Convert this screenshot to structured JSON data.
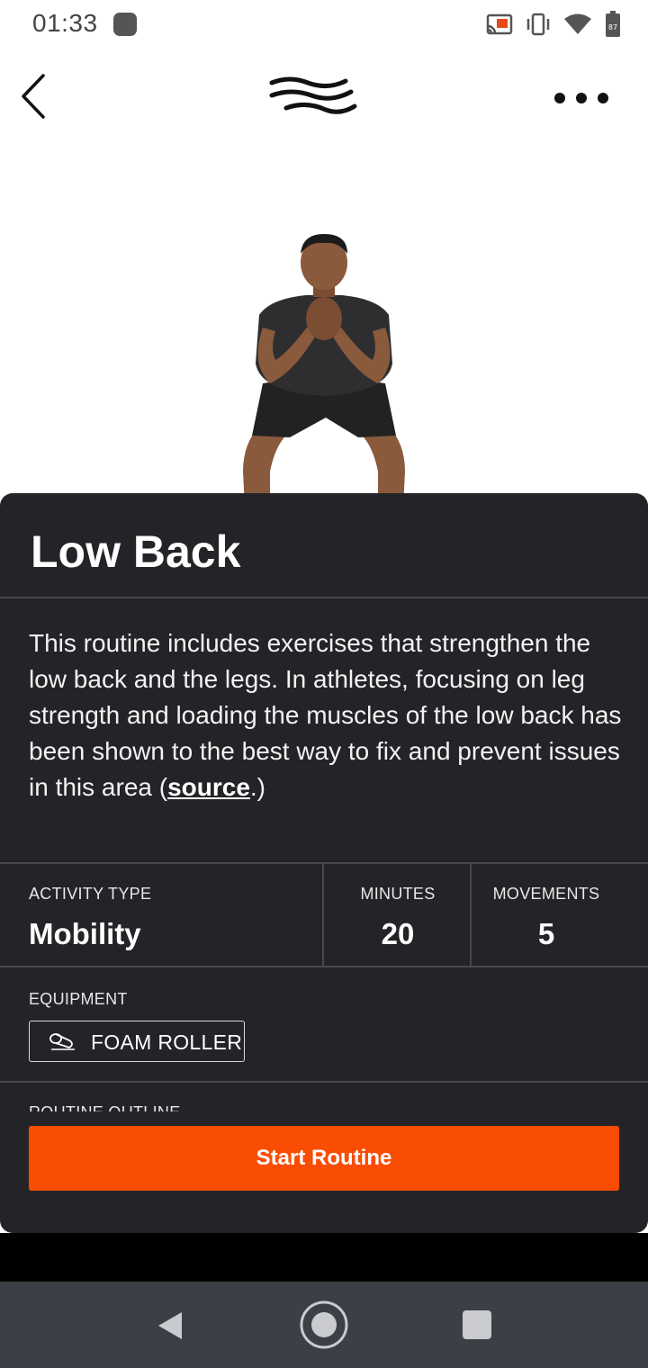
{
  "status_bar": {
    "time": "01:33",
    "battery_level": "87",
    "icons": [
      "cast-icon",
      "vibrate-icon",
      "wifi-icon",
      "battery-icon"
    ]
  },
  "app_bar": {
    "back_icon": "chevron-left-icon",
    "logo_icon": "brand-waves-logo",
    "more_icon": "more-horizontal-icon"
  },
  "routine": {
    "title": "Low Back",
    "description": "This routine includes exercises that strengthen the low back and the legs. In athletes, focusing on leg strength and loading the muscles of the low back has been shown to the best way to fix and prevent issues in this area (",
    "source_link": "source",
    "description_end": ".)",
    "stats": {
      "activity_type_label": "ACTIVITY TYPE",
      "activity_type_value": "Mobility",
      "minutes_label": "MINUTES",
      "minutes_value": "20",
      "movements_label": "MOVEMENTS",
      "movements_value": "5"
    },
    "equipment_label": "EQUIPMENT",
    "equipment_item": "FOAM ROLLER",
    "outline_label": "ROUTINE OUTLINE",
    "start_button": "Start Routine"
  },
  "colors": {
    "sheet_background": "#242428",
    "accent": "#fa4d04",
    "nav_bar": "#3c4046"
  }
}
